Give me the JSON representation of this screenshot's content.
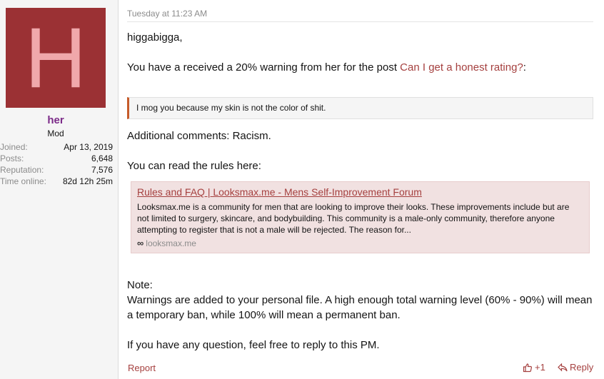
{
  "user": {
    "avatar_letter": "H",
    "name": "her",
    "role": "Mod",
    "stats": [
      {
        "label": "Joined:",
        "value": "Apr 13, 2019"
      },
      {
        "label": "Posts:",
        "value": "6,648"
      },
      {
        "label": "Reputation:",
        "value": "7,576"
      },
      {
        "label": "Time online:",
        "value": "82d 12h 25m"
      }
    ]
  },
  "post": {
    "date": "Tuesday at 11:23 AM",
    "greeting": "higgabigga,",
    "warning_text": "You have a received a 20% warning from her for the post ",
    "warning_link": "Can I get a honest rating?",
    "warning_suffix": ":",
    "quote": "I mog you because my skin is not the color of shit.",
    "comments": "Additional comments: Racism.",
    "rules_intro": "You can read the rules here:",
    "embed": {
      "title": "Rules and FAQ | Looksmax.me - Mens Self-Improvement Forum",
      "description": "Looksmax.me is a community for men that are looking to improve their looks. These improvements include but are not limited to surgery, skincare, and bodybuilding. This community is a male-only community, therefore anyone attempting to register that is not a male will be rejected. The reason for...",
      "site": "looksmax.me"
    },
    "note_label": "Note:",
    "note_text": "Warnings are added to your personal file. A high enough total warning level (60% - 90%) will mean a temporary ban, while 100% will mean a permanent ban.",
    "closing": "If you have any question, feel free to reply to this PM."
  },
  "actions": {
    "report": "Report",
    "like_count": "+1",
    "reply": "Reply"
  },
  "colors": {
    "avatar_bg": "#9b3134",
    "avatar_letter": "#f0a8ab",
    "username": "#7b2a88",
    "link": "#a5403f",
    "quote_accent": "#c65b2a",
    "embed_bg": "#f1e1e1"
  }
}
